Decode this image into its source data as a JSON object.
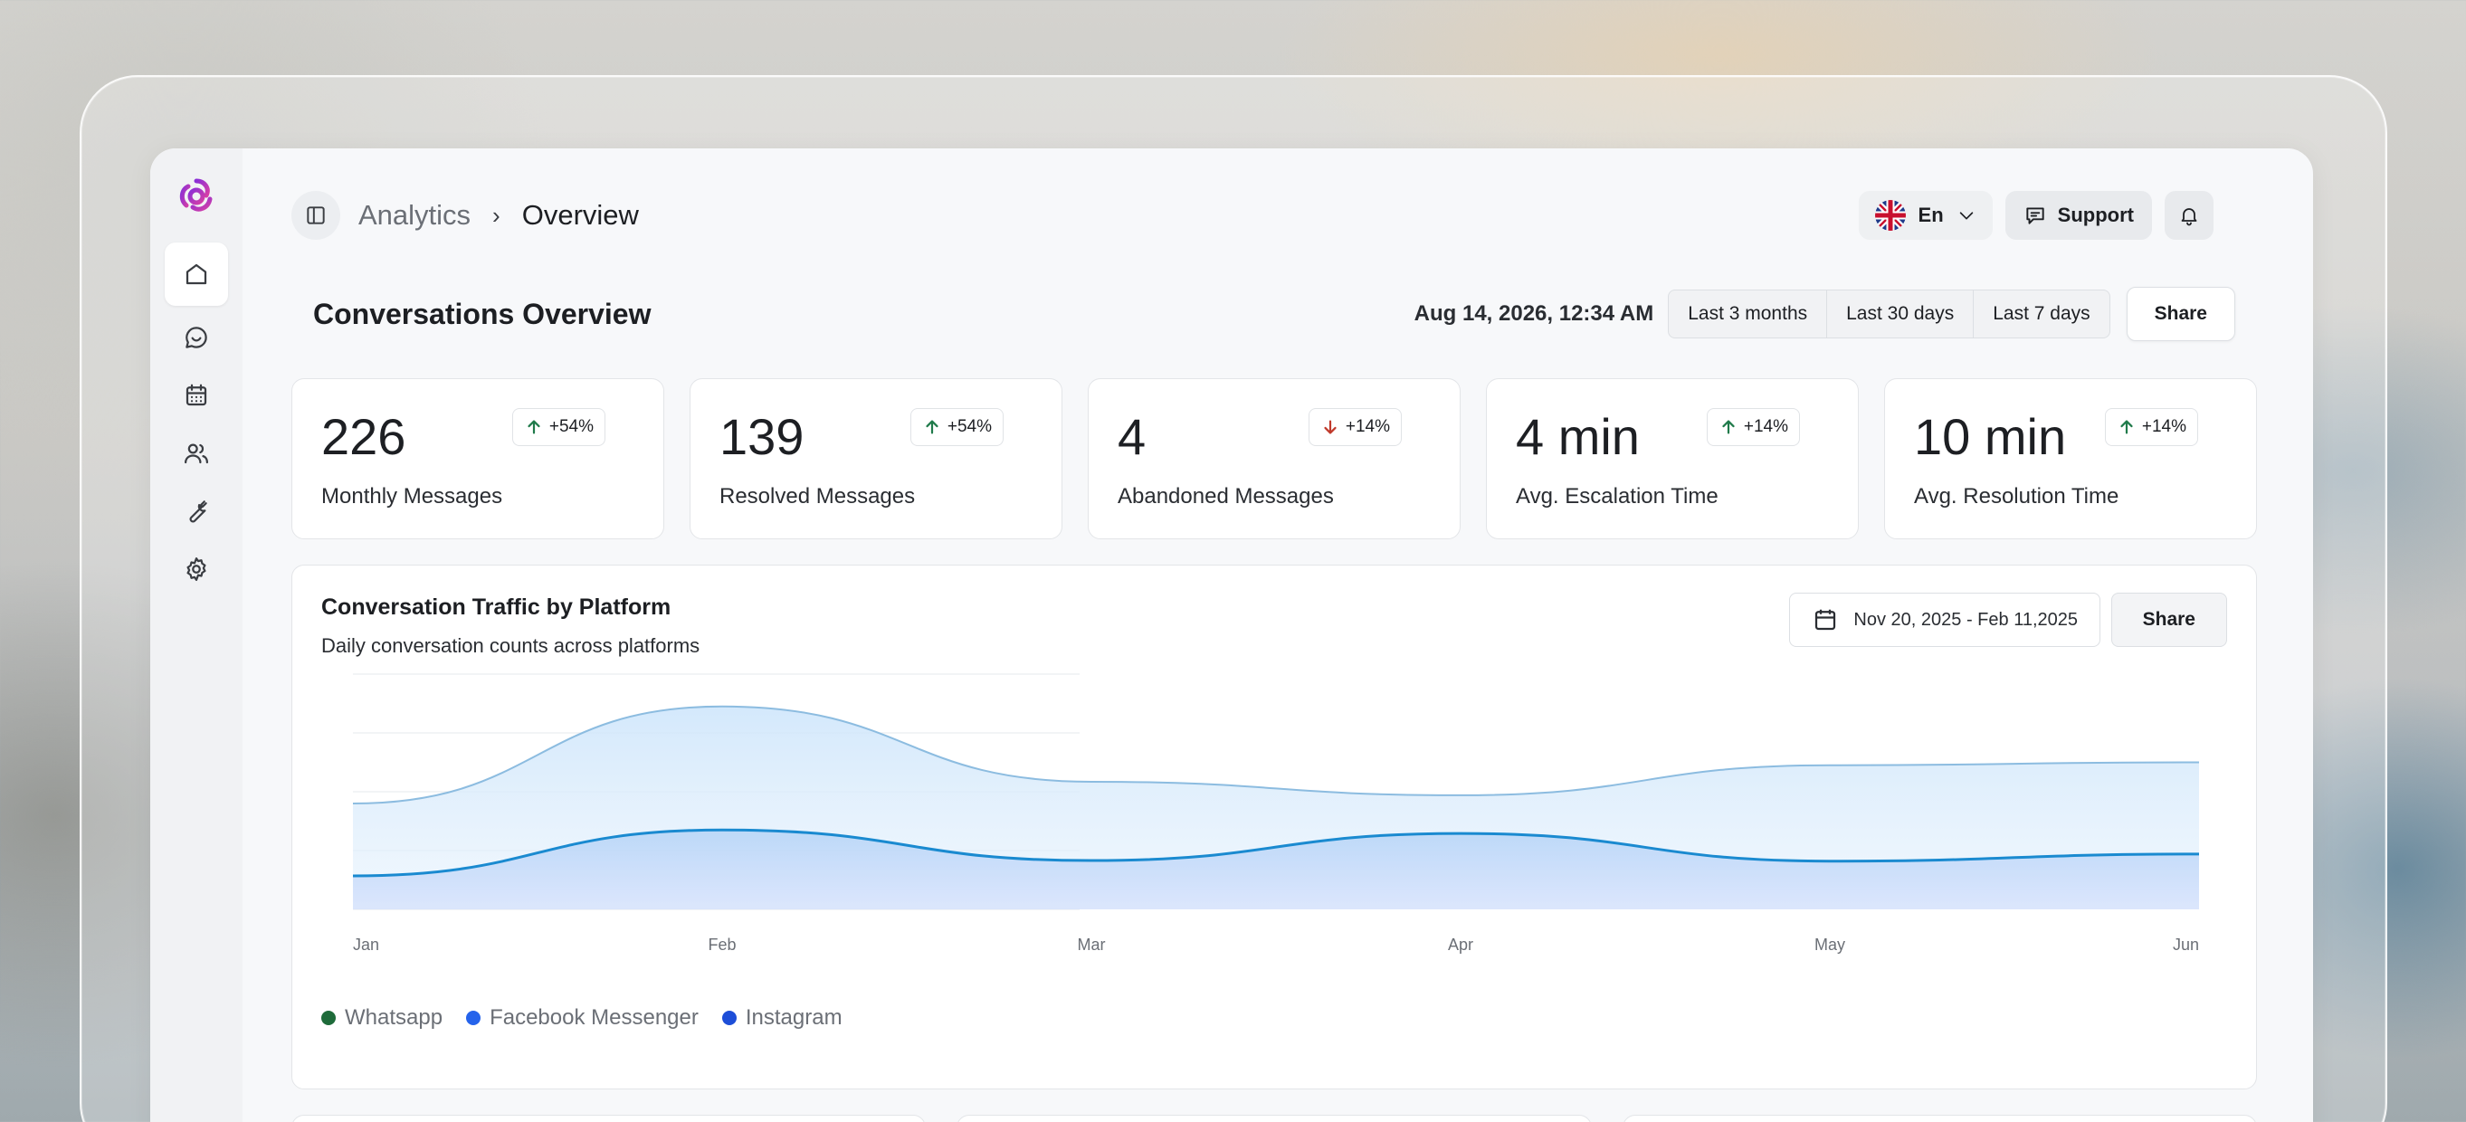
{
  "breadcrumb": {
    "parent": "Analytics",
    "separator": "›",
    "current": "Overview"
  },
  "header": {
    "language": "En",
    "support_label": "Support"
  },
  "overview": {
    "title": "Conversations Overview",
    "timestamp": "Aug 14, 2026, 12:34 AM",
    "ranges": [
      "Last 3 months",
      "Last 30 days",
      "Last 7 days"
    ],
    "share_label": "Share"
  },
  "stats": [
    {
      "value": "226",
      "label": "Monthly Messages",
      "change": "+54%",
      "direction": "up"
    },
    {
      "value": "139",
      "label": "Resolved Messages",
      "change": "+54%",
      "direction": "up"
    },
    {
      "value": "4",
      "label": "Abandoned Messages",
      "change": "+14%",
      "direction": "down"
    },
    {
      "value": "4 min",
      "label": "Avg. Escalation Time",
      "change": "+14%",
      "direction": "up"
    },
    {
      "value": "10 min",
      "label": "Avg. Resolution Time",
      "change": "+14%",
      "direction": "up"
    }
  ],
  "chart_panel": {
    "title": "Conversation Traffic by Platform",
    "subtitle": "Daily conversation counts across platforms",
    "date_range": "Nov 20, 2025 - Feb 11,2025",
    "share_label": "Share"
  },
  "colors": {
    "up": "#1f7a4a",
    "down": "#c0392b",
    "whatsapp": "#1e6b3a",
    "messenger": "#2563eb",
    "instagram": "#1d4ed8",
    "line_light": "#8cbce0",
    "line_dark": "#1a8ad0"
  },
  "chart_data": {
    "type": "area",
    "categories": [
      "Jan",
      "Feb",
      "Mar",
      "Apr",
      "May",
      "Jun"
    ],
    "series": [
      {
        "name": "Whatsapp",
        "values": [
          180,
          345,
          217,
          194,
          245,
          250
        ]
      },
      {
        "name": "Facebook Messenger",
        "values": [
          57,
          135,
          83,
          129,
          82,
          94
        ]
      }
    ],
    "legend": [
      "Whatsapp",
      "Facebook Messenger",
      "Instagram"
    ],
    "ylim": [
      0,
      400
    ],
    "grid": true,
    "legend_position": "bottom-left"
  }
}
